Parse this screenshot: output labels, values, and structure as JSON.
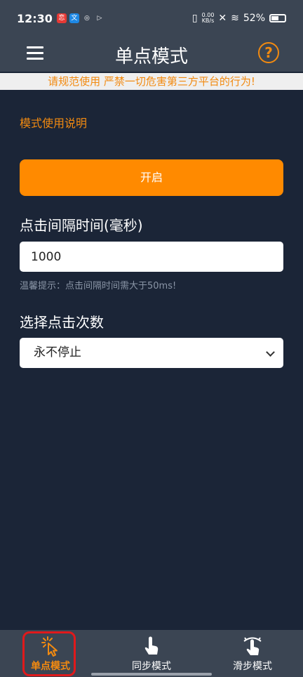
{
  "status_bar": {
    "time": "12:30",
    "apps": [
      {
        "icon": "red-app-icon",
        "glyph": "恋",
        "color": "#e53935"
      },
      {
        "icon": "blue-app-icon",
        "glyph": "文",
        "color": "#1e88e5"
      },
      {
        "icon": "swirl-app-icon",
        "glyph": "◎",
        "color": "#3b4553"
      },
      {
        "icon": "play-app-icon",
        "glyph": "▷",
        "color": "#3b4553"
      }
    ],
    "net_speed_value": "0.00",
    "net_speed_unit": "KB/s",
    "battery_percent": "52%"
  },
  "header": {
    "title": "单点模式",
    "help_glyph": "?"
  },
  "warning_banner": "请规范使用 严禁一切危害第三方平台的行为!",
  "content": {
    "instructions_link": "模式使用说明",
    "start_button": "开启",
    "interval_label": "点击间隔时间(毫秒)",
    "interval_value": "1000",
    "interval_hint": "温馨提示：点击间隔时间需大于50ms!",
    "count_label": "选择点击次数",
    "count_selected": "永不停止"
  },
  "bottom_nav": {
    "items": [
      {
        "label": "单点模式",
        "icon": "tap-sparkle-icon",
        "active": true
      },
      {
        "label": "同步模式",
        "icon": "finger-tap-icon",
        "active": false
      },
      {
        "label": "滑步模式",
        "icon": "finger-swipe-icon",
        "active": false
      }
    ]
  },
  "colors": {
    "accent": "#ff8a00",
    "background": "#1b2537",
    "bar": "#3b4553",
    "highlight_outline": "#e0191b"
  }
}
